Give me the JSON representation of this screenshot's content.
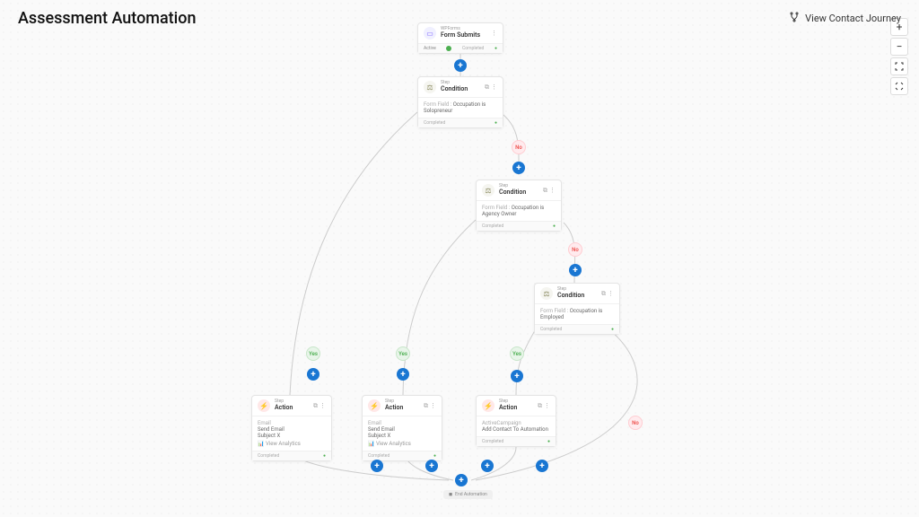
{
  "header": {
    "title": "Assessment Automation",
    "journey_button": "View Contact Journey"
  },
  "nodes": {
    "trigger": {
      "supertitle": "WPForms",
      "title": "Form Submits",
      "footer_left": "Active",
      "footer_right": "Completed"
    },
    "condition1": {
      "supertitle": "Step",
      "title": "Condition",
      "body_label": "Form Field :",
      "body_value": "Occupation is Solopreneur",
      "footer": "Completed"
    },
    "condition2": {
      "supertitle": "Step",
      "title": "Condition",
      "body_label": "Form Field :",
      "body_value": "Occupation is Agency Owner",
      "footer": "Completed"
    },
    "condition3": {
      "supertitle": "Step",
      "title": "Condition",
      "body_label": "Form Field :",
      "body_value": "Occupation is Employed",
      "footer": "Completed"
    },
    "action1": {
      "supertitle": "Step",
      "title": "Action",
      "body_label": "Email",
      "body_line1": "Send Email",
      "body_line2": "Subject X",
      "analytics": "View Analytics",
      "footer": "Completed"
    },
    "action2": {
      "supertitle": "Step",
      "title": "Action",
      "body_label": "Email",
      "body_line1": "Send Email",
      "body_line2": "Subject X",
      "analytics": "View Analytics",
      "footer": "Completed"
    },
    "action3": {
      "supertitle": "Step",
      "title": "Action",
      "body_label": "ActiveCampaign",
      "body_line1": "Add Contact To Automation",
      "footer": "Completed"
    },
    "end": {
      "label": "End Automation"
    }
  },
  "branches": {
    "yes": "Yes",
    "no": "No"
  }
}
